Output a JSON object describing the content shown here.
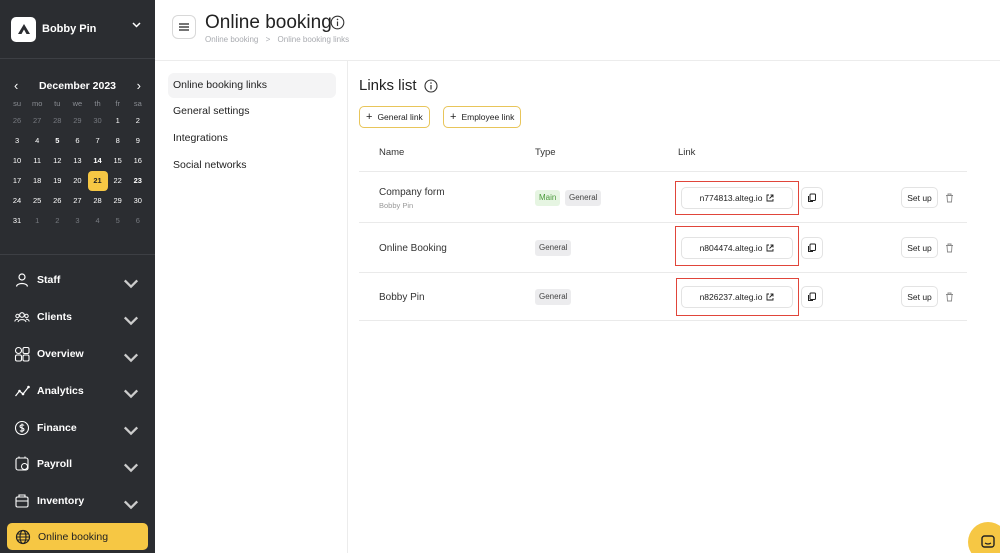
{
  "brand": {
    "name": "Bobby Pin"
  },
  "calendar": {
    "title": "December 2023",
    "weekdays": [
      "su",
      "mo",
      "tu",
      "we",
      "th",
      "fr",
      "sa"
    ],
    "weeks": [
      [
        {
          "d": "26",
          "m": 1
        },
        {
          "d": "27",
          "m": 1
        },
        {
          "d": "28",
          "m": 1
        },
        {
          "d": "29",
          "m": 1
        },
        {
          "d": "30",
          "m": 1
        },
        {
          "d": "1"
        },
        {
          "d": "2"
        }
      ],
      [
        {
          "d": "3"
        },
        {
          "d": "4"
        },
        {
          "d": "5",
          "b": 1
        },
        {
          "d": "6"
        },
        {
          "d": "7"
        },
        {
          "d": "8"
        },
        {
          "d": "9"
        }
      ],
      [
        {
          "d": "10"
        },
        {
          "d": "11"
        },
        {
          "d": "12"
        },
        {
          "d": "13"
        },
        {
          "d": "14",
          "b": 1
        },
        {
          "d": "15"
        },
        {
          "d": "16"
        }
      ],
      [
        {
          "d": "17"
        },
        {
          "d": "18"
        },
        {
          "d": "19"
        },
        {
          "d": "20"
        },
        {
          "d": "21",
          "t": 1
        },
        {
          "d": "22"
        },
        {
          "d": "23",
          "b": 1
        }
      ],
      [
        {
          "d": "24"
        },
        {
          "d": "25"
        },
        {
          "d": "26"
        },
        {
          "d": "27"
        },
        {
          "d": "28"
        },
        {
          "d": "29"
        },
        {
          "d": "30"
        }
      ],
      [
        {
          "d": "31"
        },
        {
          "d": "1",
          "m": 1
        },
        {
          "d": "2",
          "m": 1
        },
        {
          "d": "3",
          "m": 1
        },
        {
          "d": "4",
          "m": 1
        },
        {
          "d": "5",
          "m": 1
        },
        {
          "d": "6",
          "m": 1
        }
      ]
    ]
  },
  "nav": {
    "items": [
      {
        "label": "Staff",
        "icon": "person-icon"
      },
      {
        "label": "Clients",
        "icon": "users-icon"
      },
      {
        "label": "Overview",
        "icon": "grid-icon"
      },
      {
        "label": "Analytics",
        "icon": "analytics-icon"
      },
      {
        "label": "Finance",
        "icon": "dollar-icon"
      },
      {
        "label": "Payroll",
        "icon": "payroll-icon"
      },
      {
        "label": "Inventory",
        "icon": "box-icon"
      }
    ],
    "active": {
      "label": "Online booking",
      "icon": "globe-icon"
    }
  },
  "header": {
    "title": "Online booking",
    "breadcrumb": [
      "Online booking",
      ">",
      "Online booking links"
    ]
  },
  "submenu": [
    "Online booking links",
    "General settings",
    "Integrations",
    "Social networks"
  ],
  "main": {
    "title": "Links list",
    "buttons": {
      "general": "General link",
      "employee": "Employee link"
    },
    "columns": {
      "name": "Name",
      "type": "Type",
      "link": "Link"
    },
    "setup_label": "Set up",
    "rows": [
      {
        "name": "Company form",
        "sub": "Bobby Pin",
        "badges": [
          "Main",
          "General"
        ],
        "link": "n774813.alteg.io"
      },
      {
        "name": "Online Booking",
        "sub": "",
        "badges": [
          "General"
        ],
        "link": "n804474.alteg.io"
      },
      {
        "name": "Bobby Pin",
        "sub": "",
        "badges": [
          "General"
        ],
        "link": "n826237.alteg.io"
      }
    ]
  },
  "colors": {
    "accent": "#f6c744",
    "sidebar": "#2b2d31",
    "highlight": "#e0453a"
  }
}
